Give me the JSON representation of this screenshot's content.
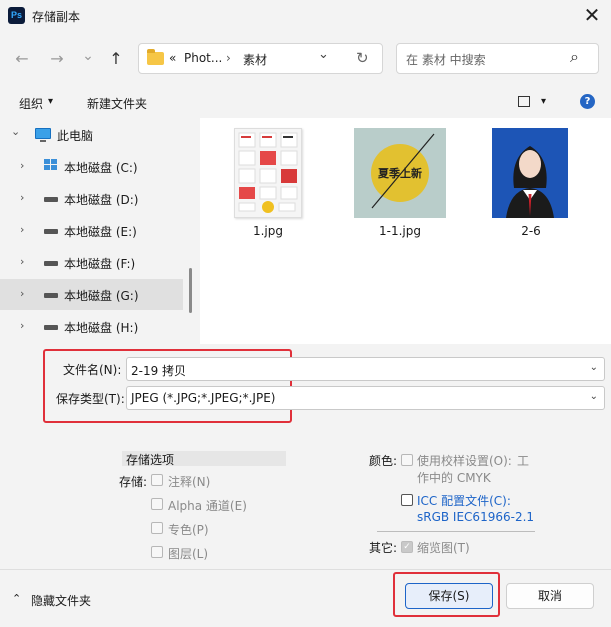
{
  "window": {
    "app_icon": "Ps",
    "title": "存储副本",
    "close": "✕"
  },
  "nav_buttons": {
    "back": "←",
    "forward": "→",
    "recent": "⌄",
    "up": "↑"
  },
  "address": {
    "prefix": "«",
    "crumb1": "Phot...",
    "sep": "›",
    "crumb2": "素材",
    "dropdown": "⌄",
    "refresh": "↻"
  },
  "search": {
    "placeholder": "在 素材 中搜索",
    "icon": "⌕"
  },
  "toolbar": {
    "organize": "组织",
    "organize_caret": "▾",
    "new_folder": "新建文件夹",
    "view_caret": "▾",
    "help": "?"
  },
  "nav": {
    "items": [
      {
        "label": "此电脑",
        "chevron": "⌄"
      },
      {
        "label": "本地磁盘 (C:)",
        "chevron": "›"
      },
      {
        "label": "本地磁盘 (D:)",
        "chevron": "›"
      },
      {
        "label": "本地磁盘 (E:)",
        "chevron": "›"
      },
      {
        "label": "本地磁盘 (F:)",
        "chevron": "›"
      },
      {
        "label": "本地磁盘 (G:)",
        "chevron": "›"
      },
      {
        "label": "本地磁盘 (H:)",
        "chevron": "›"
      }
    ]
  },
  "files": [
    {
      "name": "1.jpg"
    },
    {
      "name": "1-1.jpg",
      "thumb_text": "夏季上新"
    },
    {
      "name": "2-6"
    }
  ],
  "form": {
    "filename_label": "文件名(N):",
    "filename_value": "2-19 拷贝",
    "type_label": "保存类型(T):",
    "type_value": "JPEG (*.JPG;*.JPEG;*.JPE)",
    "dd": "⌄"
  },
  "options": {
    "section_title": "存储选项",
    "save_label": "存储:",
    "annotations": "注释(N)",
    "alpha": "Alpha 通道(E)",
    "spot": "专色(P)",
    "layers": "图层(L)",
    "color_label": "颜色:",
    "proof_line1": "使用校样设置(O):",
    "proof_tag": "工",
    "proof_line2": "作中的 CMYK",
    "icc_line1": "ICC 配置文件(C):",
    "icc_line2": "sRGB IEC61966-2.1",
    "other_label": "其它:",
    "thumbnail": "缩览图(T)",
    "check": "✓"
  },
  "footer": {
    "toggle_caret": "⌃",
    "hide_folders": "隐藏文件夹",
    "save": "保存(S)",
    "cancel": "取消"
  }
}
